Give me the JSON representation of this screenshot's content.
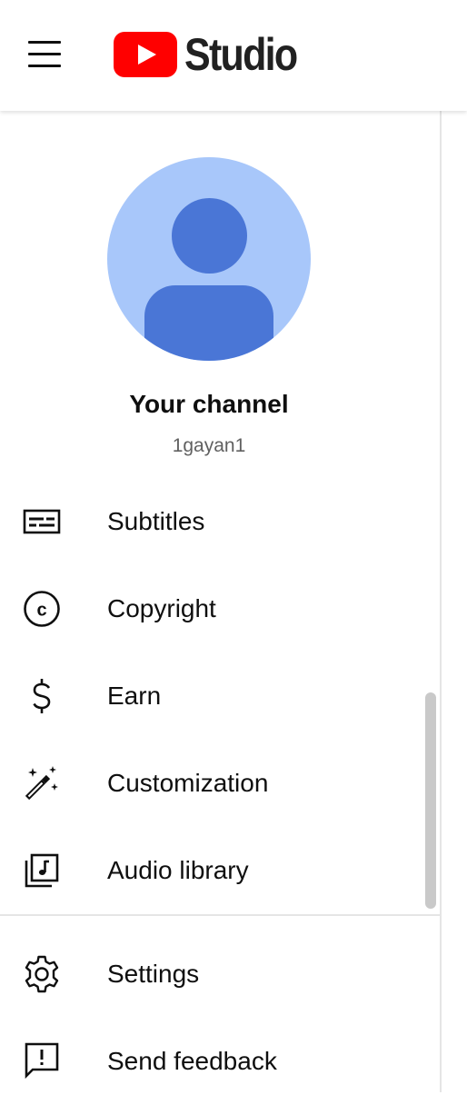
{
  "header": {
    "logo_text": "Studio",
    "logo_color": "#ff0000"
  },
  "channel": {
    "title": "Your channel",
    "handle": "1gayan1",
    "avatar_bg": "#a8c7fa",
    "avatar_fg": "#4a76d6"
  },
  "nav": {
    "items": [
      {
        "label": "Subtitles",
        "icon": "subtitles-icon"
      },
      {
        "label": "Copyright",
        "icon": "copyright-icon"
      },
      {
        "label": "Earn",
        "icon": "dollar-icon"
      },
      {
        "label": "Customization",
        "icon": "magic-wand-icon"
      },
      {
        "label": "Audio library",
        "icon": "audio-library-icon"
      }
    ],
    "bottom_items": [
      {
        "label": "Settings",
        "icon": "gear-icon"
      },
      {
        "label": "Send feedback",
        "icon": "feedback-icon"
      }
    ]
  }
}
